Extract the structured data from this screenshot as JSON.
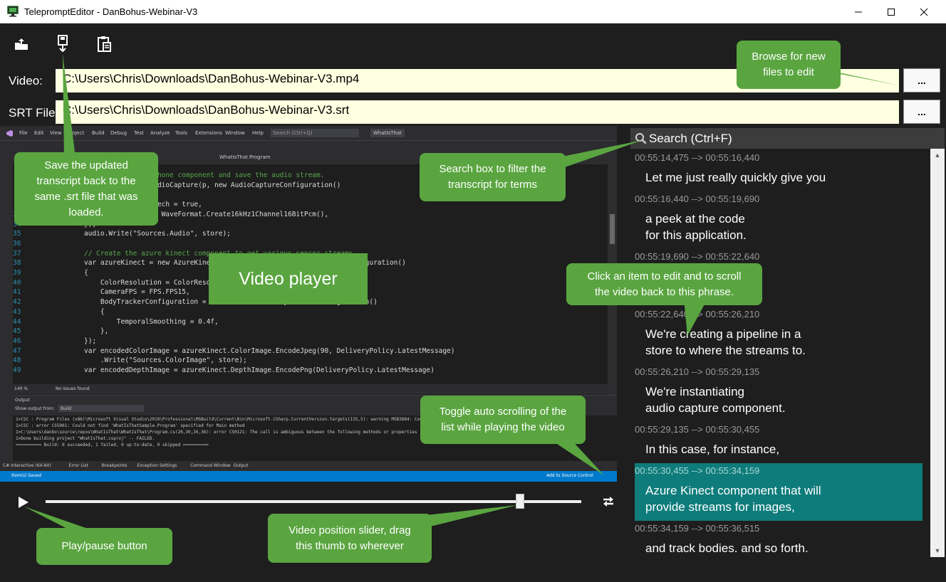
{
  "window": {
    "title": "TelepromptEditor - DanBohus-Webinar-V3",
    "controls": [
      "minimize-icon",
      "maximize-icon",
      "close-icon"
    ]
  },
  "toolbar": {
    "buttons": [
      "open-folder-icon",
      "save-icon",
      "clipboard-icon"
    ]
  },
  "video_row": {
    "label": "Video:",
    "path": "C:\\Users\\Chris\\Downloads\\DanBohus-Webinar-V3.mp4",
    "browse_label": "..."
  },
  "srt_row": {
    "label": "SRT File:",
    "path": "C:\\Users\\Chris\\Downloads\\DanBohus-Webinar-V3.srt",
    "browse_label": "..."
  },
  "video": {
    "label": "Video player",
    "ide": {
      "menus": [
        "File",
        "Edit",
        "View",
        "Project",
        "Build",
        "Debug",
        "Test",
        "Analyze",
        "Tools",
        "Extensions",
        "Window",
        "Help"
      ],
      "search_placeholder": "Search (Ctrl+Q)",
      "solution_name": "WhatIsThat",
      "editor_tab": "WhatIsThat.Program",
      "code_lines": [
        {
          "n": "",
          "t": "// Create a microphone component and save the audio stream."
        },
        {
          "n": "",
          "t": "var audio = new AudioCapture(p, new AudioCaptureConfiguration()"
        },
        {
          "n": "",
          "t": "{"
        },
        {
          "n": "",
          "t": "    OptimizeForSpeech = true,"
        },
        {
          "n": "33",
          "t": "    OutputFormat = WaveFormat.Create16kHz1Channel16BitPcm(),"
        },
        {
          "n": "34",
          "t": "});"
        },
        {
          "n": "35",
          "t": "audio.Write(\"Sources.Audio\", store);"
        },
        {
          "n": "36",
          "t": ""
        },
        {
          "n": "37",
          "t": "// Create the azure kinect component to get various sensor streams"
        },
        {
          "n": "38",
          "t": "var azureKinect = new AzureKinectSensor(p, new AzureKinectSensorConfiguration()"
        },
        {
          "n": "39",
          "t": "{"
        },
        {
          "n": "40",
          "t": "    ColorResolution = ColorResolution.R720p,"
        },
        {
          "n": "41",
          "t": "    CameraFPS = FPS.FPS15,"
        },
        {
          "n": "42",
          "t": "    BodyTrackerConfiguration = new AzureKinectBodyTrackerConfiguration()"
        },
        {
          "n": "43",
          "t": "    {"
        },
        {
          "n": "44",
          "t": "        TemporalSmoothing = 0.4f,"
        },
        {
          "n": "45",
          "t": "    },"
        },
        {
          "n": "46",
          "t": "});"
        },
        {
          "n": "47",
          "t": "var encodedColorImage = azureKinect.ColorImage.EncodeJpeg(90, DeliveryPolicy.LatestMessage)"
        },
        {
          "n": "48",
          "t": "    .Write(\"Sources.ColorImage\", store);"
        },
        {
          "n": "49",
          "t": "var encodedDepthImage = azureKinect.DepthImage.EncodePng(DeliveryPolicy.LatestMessage)"
        }
      ],
      "zoom": "140 %",
      "issues": "No issues found",
      "output_title": "Output",
      "output_from_label": "Show output from:",
      "output_from_value": "Build",
      "output_lines": [
        "1>CSC : Program Files (x86)\\Microsoft Visual Studio\\2019\\Professional\\MSBuild\\Current\\Bin\\Microsoft.CSharp.CurrentVersion.targets(135,5): warning MSB3884: Could not find rule set file",
        "1>CSC : error CS5001: Could not find 'WhatIsThatSample.Program' specified for Main method",
        "1>C:\\Users\\danbo\\source\\repos\\WhatIsThat\\WhatIsThat\\Program.cs(26,30,26,36): error CS0121: The call is ambiguous between the following methods or properties",
        "1>Done building project \"WhatIsThat.csproj\" -- FAILED.",
        "========== Build: 0 succeeded, 1 failed, 0 up-to-date, 0 skipped =========="
      ],
      "bottom_tabs": [
        "C# Interactive (64-bit)",
        "Error List",
        "Breakpoints",
        "Exception Settings",
        "Command Window",
        "Output"
      ],
      "status_left": "Item(s) Saved",
      "status_right": "Add to Source Control"
    }
  },
  "transport": {
    "position_fraction": 0.885,
    "play_icon": "play-icon",
    "autoscroll_icon": "autoscroll-toggle-icon"
  },
  "search": {
    "placeholder": "Search (Ctrl+F)"
  },
  "transcript": [
    {
      "ts": "00:55:14,475 --> 00:55:16,440",
      "lines": [
        "Let me just really quickly give you"
      ]
    },
    {
      "ts": "00:55:16,440 --> 00:55:19,690",
      "lines": [
        "a peek at the code",
        "for this application."
      ]
    },
    {
      "ts": "00:55:19,690 --> 00:55:22,640",
      "lines": [
        "",
        ""
      ]
    },
    {
      "ts": "00:55:22,640 --> 00:55:26,210",
      "lines": [
        "We're creating a pipeline in a",
        "store to where the streams to."
      ]
    },
    {
      "ts": "00:55:26,210 --> 00:55:29,135",
      "lines": [
        "We're instantiating",
        "audio capture component."
      ]
    },
    {
      "ts": "00:55:29,135 --> 00:55:30,455",
      "lines": [
        "In this case, for instance,"
      ]
    },
    {
      "ts": "00:55:30,455 --> 00:55:34,159",
      "lines": [
        "Azure Kinect component that will",
        "provide streams for images,"
      ],
      "selected": true
    },
    {
      "ts": "00:55:34,159 --> 00:55:36,515",
      "lines": [
        "and track bodies. and so forth."
      ]
    }
  ],
  "callouts": {
    "browse": [
      "Browse for new",
      "files to edit"
    ],
    "save": [
      "Save the updated",
      "transcript back to the",
      "same .srt file that was",
      "loaded."
    ],
    "search": [
      "Search box to filter the",
      "transcript for terms"
    ],
    "click_item": [
      "Click an item to edit and to scroll",
      "the video back to this phrase."
    ],
    "autoscroll": [
      "Toggle auto scrolling of the",
      "list while playing the video"
    ],
    "play": [
      "Play/pause button"
    ],
    "slider": [
      "Video position slider, drag",
      "this thumb to wherever"
    ]
  },
  "colors": {
    "callout": "#5aa540",
    "selected_item": "#0e7c7b",
    "path_box": "#ffffe1",
    "ide_status": "#007acc"
  }
}
